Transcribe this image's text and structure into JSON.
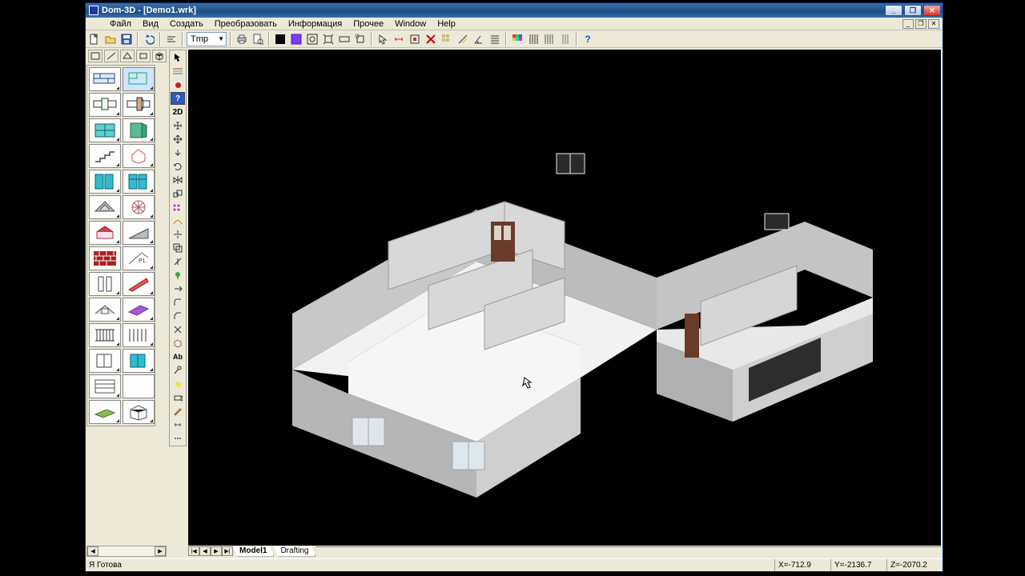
{
  "title": "Dom-3D - [Demo1.wrk]",
  "window_buttons": {
    "min": "_",
    "max": "❐",
    "close": "✕"
  },
  "menu": [
    "Файл",
    "Вид",
    "Создать",
    "Преобразовать",
    "Информация",
    "Прочее",
    "Window",
    "Help"
  ],
  "mdi": {
    "min": "_",
    "max": "❐",
    "close": "✕"
  },
  "toolbar": {
    "layer_value": "Tmp",
    "help_glyph": "?"
  },
  "mod_toolbar": {
    "twoD": "2D",
    "ab": "Ab"
  },
  "viewport_tabs": {
    "nav": [
      "|◀",
      "◀",
      "▶",
      "▶|"
    ],
    "items": [
      "Model1",
      "Drafting"
    ]
  },
  "status": {
    "msg": "Я Готова",
    "x_label": "X=",
    "x_val": "-712.9",
    "y_label": "Y=",
    "y_val": "-2136.7",
    "z_label": "Z=",
    "z_val": "-2070.2"
  }
}
